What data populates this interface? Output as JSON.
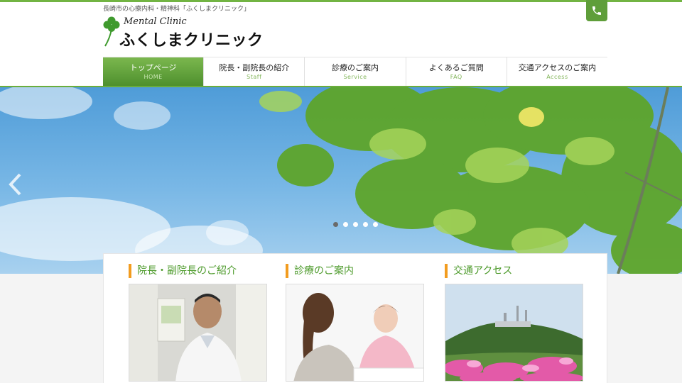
{
  "header": {
    "tagline": "長崎市の心療内科・精神科「ふくしまクリニック」",
    "logo_sub": "Mental Clinic",
    "logo_main": "ふくしまクリニック",
    "phone_icon": "phone-icon"
  },
  "nav": {
    "items": [
      {
        "label": "トップページ",
        "sub": "HOME"
      },
      {
        "label": "院長・副院長の紹介",
        "sub": "Staff"
      },
      {
        "label": "診療のご案内",
        "sub": "Service"
      },
      {
        "label": "よくあるご質問",
        "sub": "FAQ"
      },
      {
        "label": "交通アクセスのご案内",
        "sub": "Access"
      }
    ],
    "active_index": 0
  },
  "hero": {
    "slide_count": 5,
    "active_slide": 1,
    "prev_icon": "chevron-left-icon"
  },
  "cards": [
    {
      "title": "院長・副院長のご紹介"
    },
    {
      "title": "診療のご案内"
    },
    {
      "title": "交通アクセス"
    }
  ],
  "colors": {
    "brand_green": "#72b443",
    "accent_orange": "#f29c1f",
    "title_green": "#4c9a2a"
  }
}
